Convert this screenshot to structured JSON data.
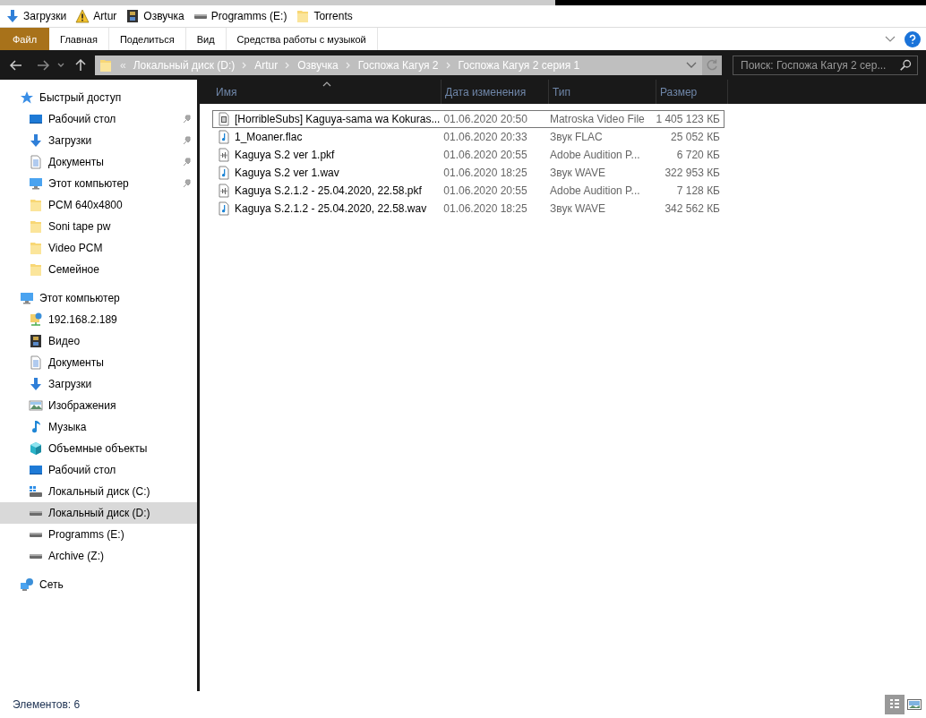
{
  "quick_toolbar": [
    {
      "kind": "download",
      "label": "Загрузки"
    },
    {
      "kind": "warning",
      "label": "Artur"
    },
    {
      "kind": "film",
      "label": "Озвучка"
    },
    {
      "kind": "drive",
      "label": "Programms (E:)"
    },
    {
      "kind": "folder",
      "label": "Torrents"
    }
  ],
  "ribbon_tabs": [
    {
      "label": "Файл",
      "kind": "file"
    },
    {
      "label": "Главная",
      "kind": "tab"
    },
    {
      "label": "Поделиться",
      "kind": "tab"
    },
    {
      "label": "Вид",
      "kind": "tab"
    },
    {
      "label": "Средства работы с музыкой",
      "kind": "tab"
    }
  ],
  "address": {
    "overflow": "«",
    "crumbs": [
      "Локальный диск (D:)",
      "Artur",
      "Озвучка",
      "Госпожа Кагуя 2",
      "Госпожа Кагуя 2 серия 1"
    ]
  },
  "search": {
    "placeholder": "Поиск: Госпожа Кагуя 2 сер..."
  },
  "nav": [
    {
      "kind": "star",
      "label": "Быстрый доступ",
      "selected": false,
      "children": [
        {
          "kind": "desktop",
          "label": "Рабочий стол",
          "selected": false,
          "pinned": true
        },
        {
          "kind": "download",
          "label": "Загрузки",
          "selected": false,
          "pinned": true
        },
        {
          "kind": "document",
          "label": "Документы",
          "selected": false,
          "pinned": true
        },
        {
          "kind": "computer",
          "label": "Этот компьютер",
          "selected": false,
          "pinned": true
        },
        {
          "kind": "folder",
          "label": "PCM 640x4800",
          "selected": false,
          "pinned": false
        },
        {
          "kind": "folder",
          "label": "Soni tape pw",
          "selected": false,
          "pinned": false
        },
        {
          "kind": "folder",
          "label": "Video PCM",
          "selected": false,
          "pinned": false
        },
        {
          "kind": "folder",
          "label": "Семейное",
          "selected": false,
          "pinned": false
        }
      ]
    },
    {
      "kind": "computer",
      "label": "Этот компьютер",
      "selected": false,
      "children": [
        {
          "kind": "network-drive",
          "label": "192.168.2.189",
          "selected": false
        },
        {
          "kind": "film",
          "label": "Видео",
          "selected": false
        },
        {
          "kind": "document",
          "label": "Документы",
          "selected": false
        },
        {
          "kind": "download",
          "label": "Загрузки",
          "selected": false
        },
        {
          "kind": "image",
          "label": "Изображения",
          "selected": false
        },
        {
          "kind": "music",
          "label": "Музыка",
          "selected": false
        },
        {
          "kind": "cube",
          "label": "Объемные объекты",
          "selected": false
        },
        {
          "kind": "desktop",
          "label": "Рабочий стол",
          "selected": false
        },
        {
          "kind": "windows-drive",
          "label": "Локальный диск (C:)",
          "selected": false
        },
        {
          "kind": "drive",
          "label": "Локальный диск (D:)",
          "selected": true
        },
        {
          "kind": "drive",
          "label": "Programms (E:)",
          "selected": false
        },
        {
          "kind": "drive",
          "label": "Archive (Z:)",
          "selected": false
        }
      ]
    },
    {
      "kind": "network",
      "label": "Сеть",
      "selected": false
    }
  ],
  "table": {
    "columns": [
      {
        "label": "Имя",
        "sorted": true
      },
      {
        "label": "Дата изменения",
        "sorted": false
      },
      {
        "label": "Тип",
        "sorted": false
      },
      {
        "label": "Размер",
        "sorted": false
      }
    ],
    "rows": [
      {
        "kind": "video-file",
        "name": "[HorribleSubs] Kaguya-sama wa Kokuras...",
        "date": "01.06.2020 20:50",
        "type": "Matroska Video File",
        "size": "1 405 123 КБ",
        "focused": true
      },
      {
        "kind": "audio-file",
        "name": "1_Moaner.flac",
        "date": "01.06.2020 20:33",
        "type": "Звук FLAC",
        "size": "25 052 КБ",
        "focused": false
      },
      {
        "kind": "audition-file",
        "name": "Kaguya S.2 ver 1.pkf",
        "date": "01.06.2020 20:55",
        "type": "Adobe Audition P...",
        "size": "6 720 КБ",
        "focused": false
      },
      {
        "kind": "audio-file",
        "name": "Kaguya S.2 ver 1.wav",
        "date": "01.06.2020 18:25",
        "type": "Звук WAVE",
        "size": "322 953 КБ",
        "focused": false
      },
      {
        "kind": "audition-file",
        "name": "Kaguya S.2.1.2 - 25.04.2020, 22.58.pkf",
        "date": "01.06.2020 20:55",
        "type": "Adobe Audition P...",
        "size": "7 128 КБ",
        "focused": false
      },
      {
        "kind": "audio-file",
        "name": "Kaguya S.2.1.2 - 25.04.2020, 22.58.wav",
        "date": "01.06.2020 18:25",
        "type": "Звук WAVE",
        "size": "342 562 КБ",
        "focused": false
      }
    ]
  },
  "status_bar": {
    "count": "Элементов: 6",
    "views": [
      {
        "kind": "details",
        "selected": true
      },
      {
        "kind": "tiles",
        "selected": false
      }
    ]
  }
}
